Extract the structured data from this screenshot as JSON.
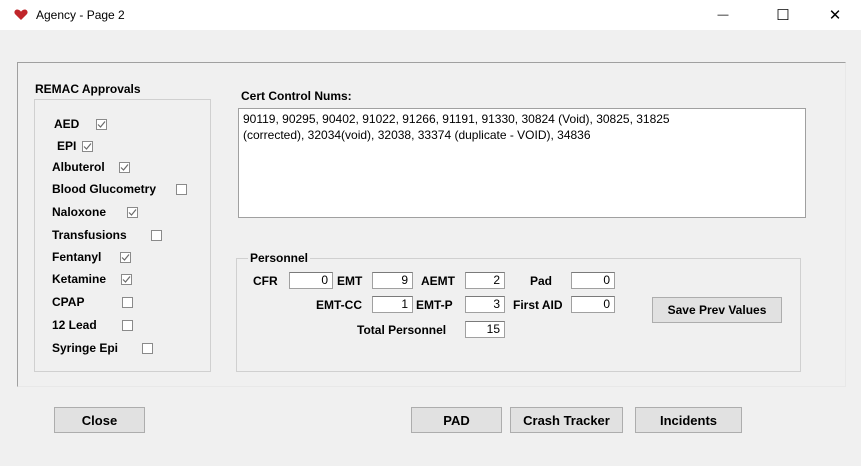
{
  "window": {
    "title": "Agency - Page 2",
    "minimize_glyph": "—",
    "maximize_glyph": "☐",
    "close_glyph": "✕"
  },
  "remac": {
    "heading": "REMAC Approvals",
    "items": [
      {
        "label": "AED",
        "checked": true
      },
      {
        "label": "EPI",
        "checked": true
      },
      {
        "label": "Albuterol",
        "checked": true
      },
      {
        "label": "Blood Glucometry",
        "checked": false
      },
      {
        "label": "Naloxone",
        "checked": true
      },
      {
        "label": "Transfusions",
        "checked": false
      },
      {
        "label": "Fentanyl",
        "checked": true
      },
      {
        "label": "Ketamine",
        "checked": true
      },
      {
        "label": "CPAP",
        "checked": false
      },
      {
        "label": "12 Lead",
        "checked": false
      },
      {
        "label": "Syringe Epi",
        "checked": false
      }
    ]
  },
  "cert": {
    "heading": "Cert Control Nums:",
    "value": "90119, 90295, 90402, 91022, 91266, 91191, 91330, 30824 (Void), 30825, 31825\n(corrected), 32034(void), 32038, 33374 (duplicate - VOID), 34836"
  },
  "personnel": {
    "heading": "Personnel",
    "cfr_label": "CFR",
    "cfr_value": "0",
    "emt_label": "EMT",
    "emt_value": "9",
    "aemt_label": "AEMT",
    "aemt_value": "2",
    "pad_label": "Pad",
    "pad_value": "0",
    "emtcc_label": "EMT-CC",
    "emtcc_value": "1",
    "emtp_label": "EMT-P",
    "emtp_value": "3",
    "firstaid_label": "First AID",
    "firstaid_value": "0",
    "total_label": "Total Personnel",
    "total_value": "15",
    "save_label": "Save Prev Values"
  },
  "buttons": {
    "close": "Close",
    "pad": "PAD",
    "crash": "Crash Tracker",
    "incidents": "Incidents"
  },
  "colors": {
    "icon_heart": "#c0252a",
    "check": "#6b6b6b"
  }
}
